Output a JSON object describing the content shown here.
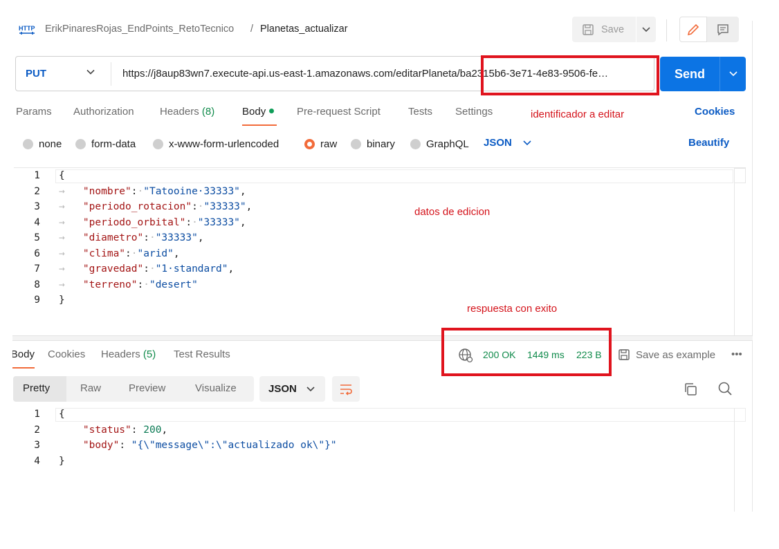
{
  "header": {
    "http_badge": "HTTP",
    "collection": "ErikPinaresRojas_EndPoints_RetoTecnico",
    "separator": "/",
    "request_name": "Planetas_actualizar",
    "save_label": "Save"
  },
  "request": {
    "method": "PUT",
    "url": "https://j8aup83wn7.execute-api.us-east-1.amazonaws.com/editarPlaneta/ba2315b6-3e71-4e83-9506-fe…",
    "send_label": "Send"
  },
  "annotations": {
    "id_note": "identificador a editar",
    "data_note": "datos de edicion",
    "response_note": "respuesta con exito"
  },
  "request_tabs": {
    "params": "Params",
    "authorization": "Authorization",
    "headers": "Headers",
    "headers_count": "(8)",
    "body": "Body",
    "prerequest": "Pre-request Script",
    "tests": "Tests",
    "settings": "Settings",
    "cookies": "Cookies"
  },
  "body_types": {
    "none": "none",
    "form_data": "form-data",
    "urlencoded": "x-www-form-urlencoded",
    "raw": "raw",
    "binary": "binary",
    "graphql": "GraphQL",
    "format": "JSON",
    "beautify": "Beautify"
  },
  "request_body": {
    "line_numbers": [
      "1",
      "2",
      "3",
      "4",
      "5",
      "6",
      "7",
      "8",
      "9"
    ],
    "open": "{",
    "close": "}",
    "fields": [
      {
        "key": "\"nombre\"",
        "value": "\"Tatooine·33333\""
      },
      {
        "key": "\"periodo_rotacion\"",
        "value": "\"33333\""
      },
      {
        "key": "\"periodo_orbital\"",
        "value": "\"33333\""
      },
      {
        "key": "\"diametro\"",
        "value": "\"33333\""
      },
      {
        "key": "\"clima\"",
        "value": "\"arid\""
      },
      {
        "key": "\"gravedad\"",
        "value": "\"1·standard\""
      },
      {
        "key": "\"terreno\"",
        "value": "\"desert\""
      }
    ]
  },
  "response_tabs": {
    "body": "Body",
    "cookies": "Cookies",
    "headers": "Headers",
    "headers_count": "(5)",
    "test_results": "Test Results"
  },
  "response_meta": {
    "status": "200 OK",
    "time": "1449 ms",
    "size": "223 B",
    "save_example": "Save as example",
    "more": "•••"
  },
  "response_view": {
    "pretty": "Pretty",
    "raw": "Raw",
    "preview": "Preview",
    "visualize": "Visualize",
    "format": "JSON"
  },
  "response_body": {
    "line_numbers": [
      "1",
      "2",
      "3",
      "4"
    ],
    "open": "{",
    "status_key": "\"status\"",
    "status_value": "200",
    "body_key": "\"body\"",
    "body_value": "\"{\\\"message\\\":\\\"actualizado ok\\\"}\"",
    "close": "}"
  },
  "colors": {
    "accent_orange": "#f26b3a",
    "send_blue": "#0c74e4",
    "link_blue": "#0b5bc4",
    "success_green": "#0f8a4a",
    "annotation_red": "#e0141e"
  }
}
